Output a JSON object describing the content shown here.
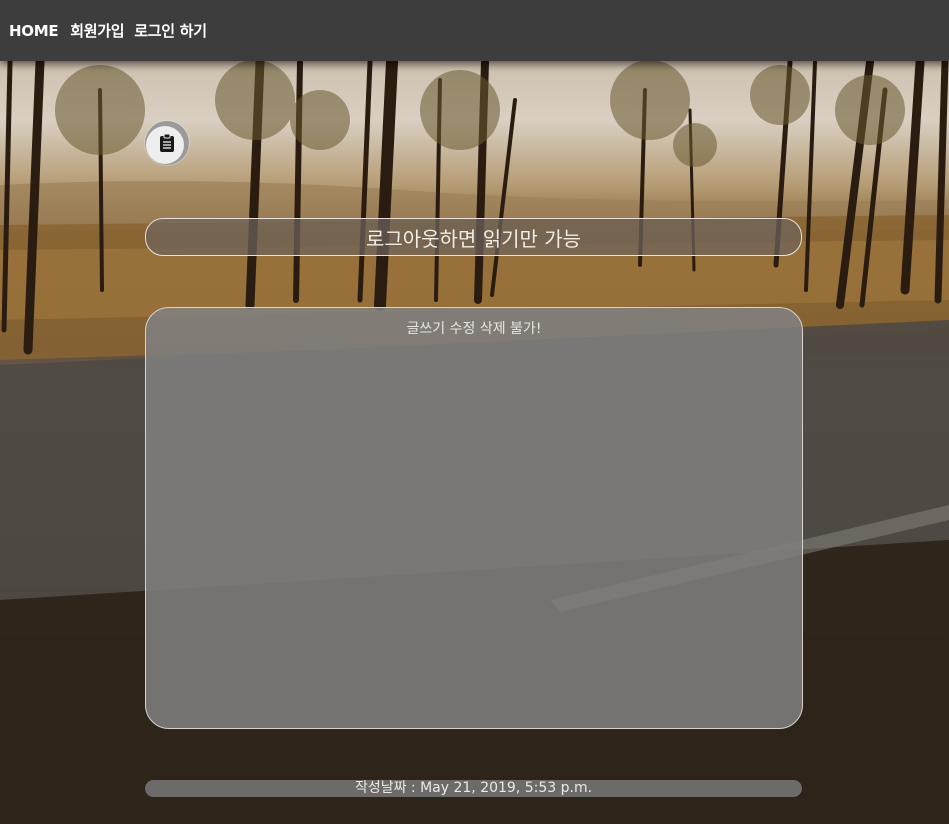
{
  "nav": {
    "home_label": "HOME",
    "signup_label": "회원가입",
    "login_label": "로그인 하기"
  },
  "post": {
    "icon": "clipboard-icon",
    "title": "로그아웃하면 읽기만 가능",
    "content": "글쓰기 수정 삭제 불가!",
    "date": "작성날짜 : May 21, 2019, 5:53 p.m."
  },
  "colors": {
    "navbar": "#3d3d3d",
    "nav_text": "#ffffff",
    "panel": "#808080"
  }
}
